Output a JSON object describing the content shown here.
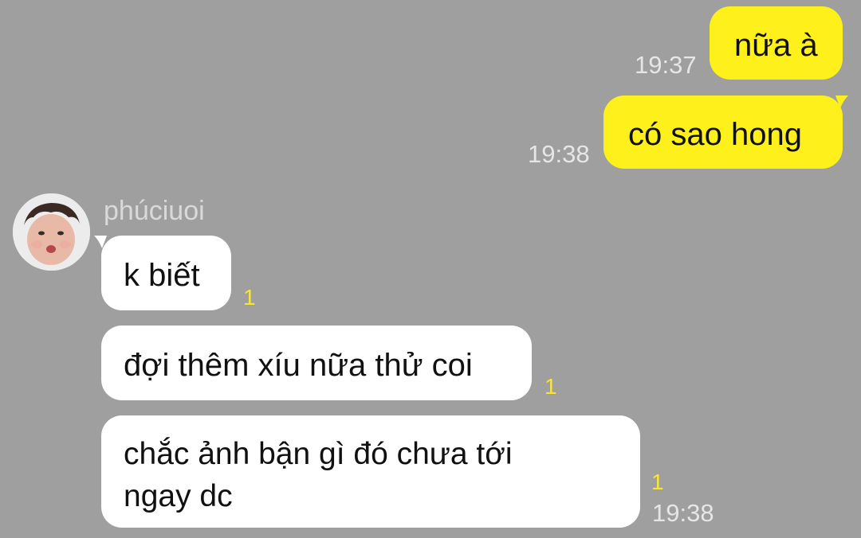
{
  "messages": {
    "out1": {
      "text": "nữa à",
      "time": "19:37"
    },
    "out2": {
      "text": "có sao hong",
      "time": "19:38"
    },
    "in1": {
      "text": "k biết",
      "unread": "1"
    },
    "in2": {
      "text": "đợi thêm xíu nữa thử coi",
      "unread": "1"
    },
    "in3": {
      "line1": "chắc ảnh bận gì đó chưa tới",
      "line2": "ngay dc",
      "unread": "1",
      "time": "19:38"
    }
  },
  "sender": {
    "name": "phúciuoi",
    "avatar": "profile-photo"
  },
  "colors": {
    "background": "#9f9f9f",
    "outgoing_bubble": "#fef01b",
    "incoming_bubble": "#ffffff",
    "unread_count": "#f7e43a",
    "timestamp": "#e6e6e6"
  }
}
